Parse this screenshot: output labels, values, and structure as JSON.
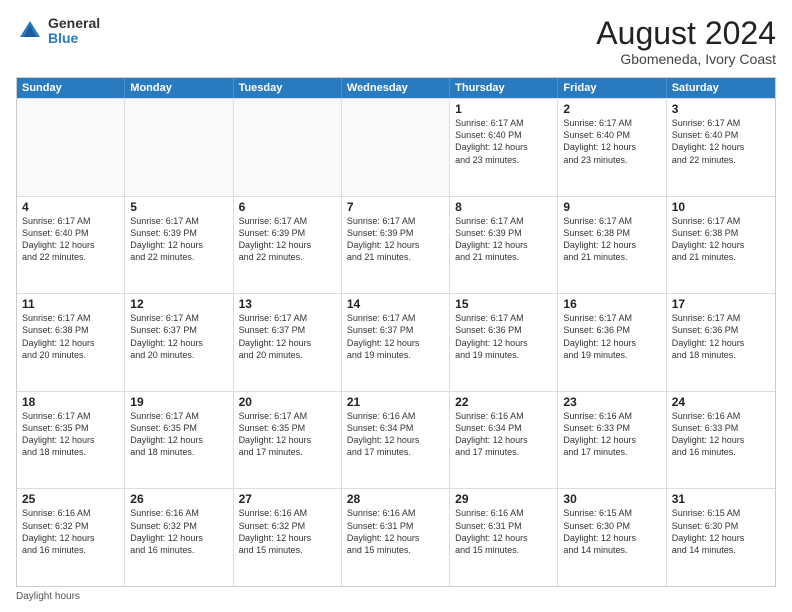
{
  "logo": {
    "general": "General",
    "blue": "Blue"
  },
  "title": "August 2024",
  "subtitle": "Gbomeneda, Ivory Coast",
  "days": [
    "Sunday",
    "Monday",
    "Tuesday",
    "Wednesday",
    "Thursday",
    "Friday",
    "Saturday"
  ],
  "weeks": [
    [
      {
        "day": "",
        "info": "",
        "shaded": true
      },
      {
        "day": "",
        "info": "",
        "shaded": true
      },
      {
        "day": "",
        "info": "",
        "shaded": true
      },
      {
        "day": "",
        "info": "",
        "shaded": true
      },
      {
        "day": "1",
        "info": "Sunrise: 6:17 AM\nSunset: 6:40 PM\nDaylight: 12 hours\nand 23 minutes.",
        "shaded": false
      },
      {
        "day": "2",
        "info": "Sunrise: 6:17 AM\nSunset: 6:40 PM\nDaylight: 12 hours\nand 23 minutes.",
        "shaded": false
      },
      {
        "day": "3",
        "info": "Sunrise: 6:17 AM\nSunset: 6:40 PM\nDaylight: 12 hours\nand 22 minutes.",
        "shaded": false
      }
    ],
    [
      {
        "day": "4",
        "info": "Sunrise: 6:17 AM\nSunset: 6:40 PM\nDaylight: 12 hours\nand 22 minutes.",
        "shaded": false
      },
      {
        "day": "5",
        "info": "Sunrise: 6:17 AM\nSunset: 6:39 PM\nDaylight: 12 hours\nand 22 minutes.",
        "shaded": false
      },
      {
        "day": "6",
        "info": "Sunrise: 6:17 AM\nSunset: 6:39 PM\nDaylight: 12 hours\nand 22 minutes.",
        "shaded": false
      },
      {
        "day": "7",
        "info": "Sunrise: 6:17 AM\nSunset: 6:39 PM\nDaylight: 12 hours\nand 21 minutes.",
        "shaded": false
      },
      {
        "day": "8",
        "info": "Sunrise: 6:17 AM\nSunset: 6:39 PM\nDaylight: 12 hours\nand 21 minutes.",
        "shaded": false
      },
      {
        "day": "9",
        "info": "Sunrise: 6:17 AM\nSunset: 6:38 PM\nDaylight: 12 hours\nand 21 minutes.",
        "shaded": false
      },
      {
        "day": "10",
        "info": "Sunrise: 6:17 AM\nSunset: 6:38 PM\nDaylight: 12 hours\nand 21 minutes.",
        "shaded": false
      }
    ],
    [
      {
        "day": "11",
        "info": "Sunrise: 6:17 AM\nSunset: 6:38 PM\nDaylight: 12 hours\nand 20 minutes.",
        "shaded": false
      },
      {
        "day": "12",
        "info": "Sunrise: 6:17 AM\nSunset: 6:37 PM\nDaylight: 12 hours\nand 20 minutes.",
        "shaded": false
      },
      {
        "day": "13",
        "info": "Sunrise: 6:17 AM\nSunset: 6:37 PM\nDaylight: 12 hours\nand 20 minutes.",
        "shaded": false
      },
      {
        "day": "14",
        "info": "Sunrise: 6:17 AM\nSunset: 6:37 PM\nDaylight: 12 hours\nand 19 minutes.",
        "shaded": false
      },
      {
        "day": "15",
        "info": "Sunrise: 6:17 AM\nSunset: 6:36 PM\nDaylight: 12 hours\nand 19 minutes.",
        "shaded": false
      },
      {
        "day": "16",
        "info": "Sunrise: 6:17 AM\nSunset: 6:36 PM\nDaylight: 12 hours\nand 19 minutes.",
        "shaded": false
      },
      {
        "day": "17",
        "info": "Sunrise: 6:17 AM\nSunset: 6:36 PM\nDaylight: 12 hours\nand 18 minutes.",
        "shaded": false
      }
    ],
    [
      {
        "day": "18",
        "info": "Sunrise: 6:17 AM\nSunset: 6:35 PM\nDaylight: 12 hours\nand 18 minutes.",
        "shaded": false
      },
      {
        "day": "19",
        "info": "Sunrise: 6:17 AM\nSunset: 6:35 PM\nDaylight: 12 hours\nand 18 minutes.",
        "shaded": false
      },
      {
        "day": "20",
        "info": "Sunrise: 6:17 AM\nSunset: 6:35 PM\nDaylight: 12 hours\nand 17 minutes.",
        "shaded": false
      },
      {
        "day": "21",
        "info": "Sunrise: 6:16 AM\nSunset: 6:34 PM\nDaylight: 12 hours\nand 17 minutes.",
        "shaded": false
      },
      {
        "day": "22",
        "info": "Sunrise: 6:16 AM\nSunset: 6:34 PM\nDaylight: 12 hours\nand 17 minutes.",
        "shaded": false
      },
      {
        "day": "23",
        "info": "Sunrise: 6:16 AM\nSunset: 6:33 PM\nDaylight: 12 hours\nand 17 minutes.",
        "shaded": false
      },
      {
        "day": "24",
        "info": "Sunrise: 6:16 AM\nSunset: 6:33 PM\nDaylight: 12 hours\nand 16 minutes.",
        "shaded": false
      }
    ],
    [
      {
        "day": "25",
        "info": "Sunrise: 6:16 AM\nSunset: 6:32 PM\nDaylight: 12 hours\nand 16 minutes.",
        "shaded": false
      },
      {
        "day": "26",
        "info": "Sunrise: 6:16 AM\nSunset: 6:32 PM\nDaylight: 12 hours\nand 16 minutes.",
        "shaded": false
      },
      {
        "day": "27",
        "info": "Sunrise: 6:16 AM\nSunset: 6:32 PM\nDaylight: 12 hours\nand 15 minutes.",
        "shaded": false
      },
      {
        "day": "28",
        "info": "Sunrise: 6:16 AM\nSunset: 6:31 PM\nDaylight: 12 hours\nand 15 minutes.",
        "shaded": false
      },
      {
        "day": "29",
        "info": "Sunrise: 6:16 AM\nSunset: 6:31 PM\nDaylight: 12 hours\nand 15 minutes.",
        "shaded": false
      },
      {
        "day": "30",
        "info": "Sunrise: 6:15 AM\nSunset: 6:30 PM\nDaylight: 12 hours\nand 14 minutes.",
        "shaded": false
      },
      {
        "day": "31",
        "info": "Sunrise: 6:15 AM\nSunset: 6:30 PM\nDaylight: 12 hours\nand 14 minutes.",
        "shaded": false
      }
    ]
  ],
  "footer": "Daylight hours"
}
